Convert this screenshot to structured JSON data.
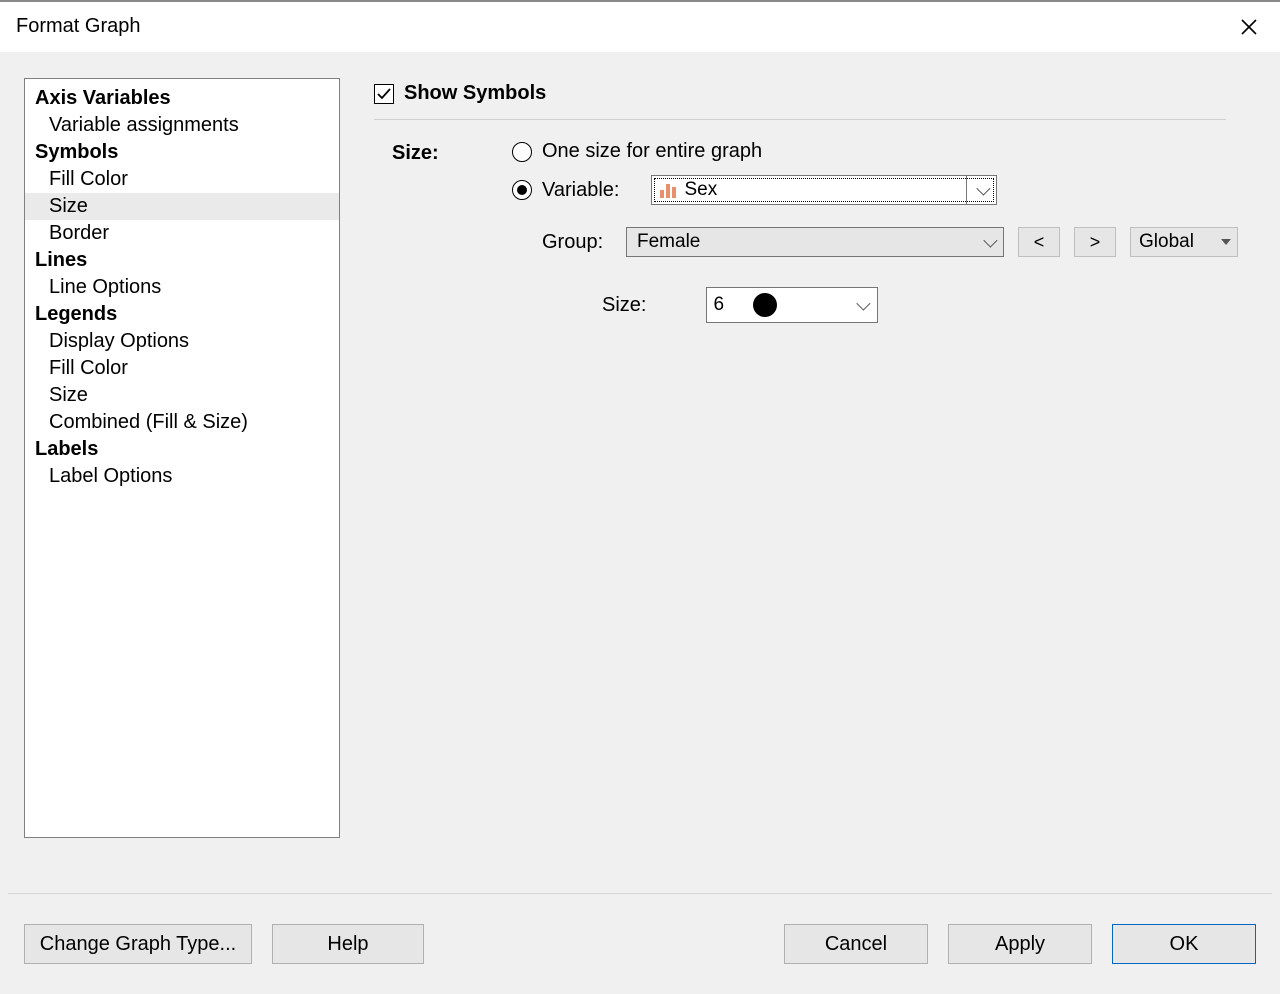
{
  "title": "Format Graph",
  "nav": {
    "sections": [
      {
        "header": "Axis Variables",
        "items": [
          "Variable assignments"
        ]
      },
      {
        "header": "Symbols",
        "items": [
          "Fill Color",
          "Size",
          "Border"
        ],
        "selected": "Size"
      },
      {
        "header": "Lines",
        "items": [
          "Line Options"
        ]
      },
      {
        "header": "Legends",
        "items": [
          "Display Options",
          "Fill Color",
          "Size",
          "Combined (Fill & Size)"
        ]
      },
      {
        "header": "Labels",
        "items": [
          "Label Options"
        ]
      }
    ]
  },
  "content": {
    "show_symbols": {
      "label": "Show Symbols",
      "checked": true
    },
    "size_label": "Size:",
    "radios": {
      "one_size": "One size for entire graph",
      "variable": "Variable:",
      "selected": "variable"
    },
    "variable_value": "Sex",
    "group_label": "Group:",
    "group_value": "Female",
    "prev": "<",
    "next": ">",
    "global": "Global",
    "size2_label": "Size:",
    "size_value": "6"
  },
  "footer": {
    "change_type": "Change Graph Type...",
    "help": "Help",
    "cancel": "Cancel",
    "apply": "Apply",
    "ok": "OK"
  }
}
